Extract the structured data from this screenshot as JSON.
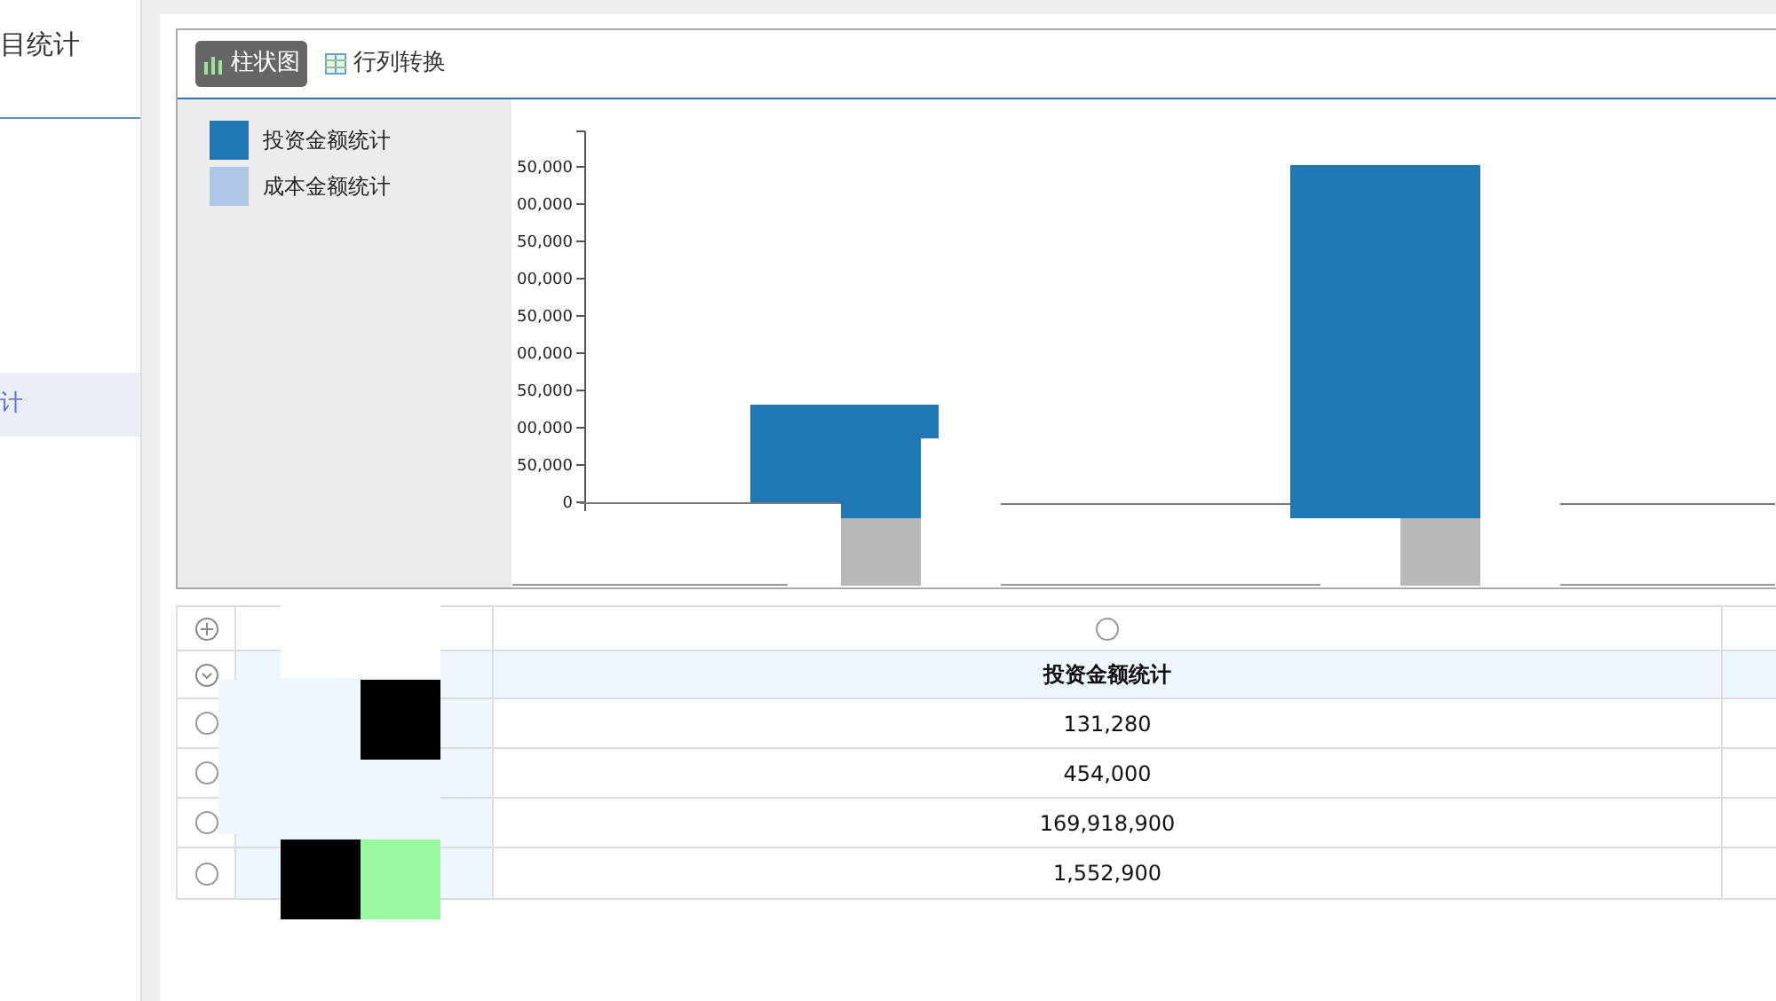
{
  "sidebar": {
    "title": "目统计",
    "items": [
      {
        "label": "计",
        "selected": true
      }
    ]
  },
  "toolbar": {
    "buttons": [
      {
        "label": "柱状图",
        "kind": "bar-chart",
        "selected": true
      },
      {
        "label": "行列转换",
        "kind": "table",
        "selected": false
      }
    ]
  },
  "legend": [
    {
      "label": "投资金额统计",
      "color": "#1f77b4"
    },
    {
      "label": "成本金额统计",
      "color": "#aec7e8"
    }
  ],
  "chart": {
    "y_tick_labels": [
      "50,000",
      "00,000",
      "50,000",
      "00,000",
      "50,000",
      "00,000",
      "50,000",
      "00,000",
      "50,000",
      "0"
    ]
  },
  "table": {
    "header_radio": {
      "selected": false
    },
    "header": "投资金额统计",
    "rows": [
      {
        "value": "131,280",
        "selected": false
      },
      {
        "value": "454,000",
        "selected": false
      },
      {
        "value": "169,918,900",
        "selected": false
      },
      {
        "value": "1,552,900",
        "selected": false
      }
    ]
  }
}
